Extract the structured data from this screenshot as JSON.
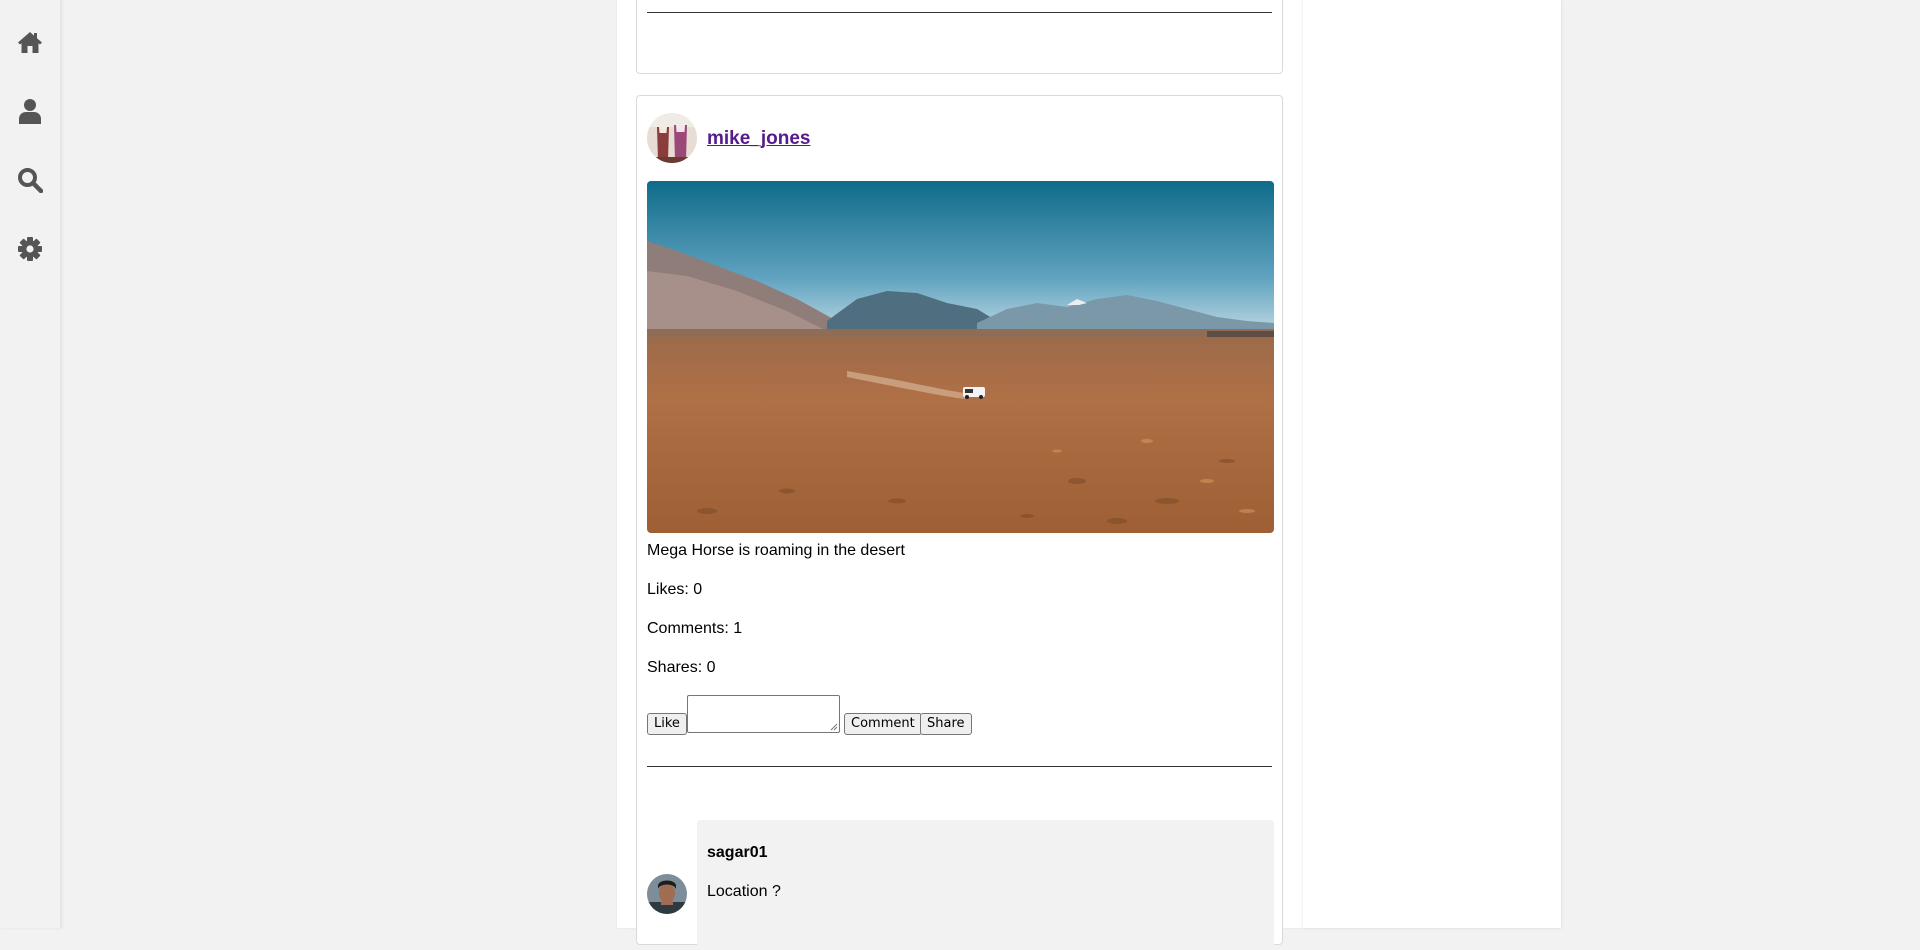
{
  "nav": {
    "items": [
      {
        "icon": "home-icon"
      },
      {
        "icon": "user-icon"
      },
      {
        "icon": "search-icon"
      },
      {
        "icon": "gear-icon"
      }
    ],
    "icon_color": "#555555"
  },
  "post": {
    "username": "mike_jones",
    "caption": "Mega Horse is roaming in the desert",
    "likes_text": "Likes: 0",
    "comments_text": "Comments: 1",
    "shares_text": "Shares: 0",
    "like_label": "Like",
    "comment_label": "Comment",
    "share_label": "Share",
    "comment_input_value": ""
  },
  "comment": {
    "author": "sagar01",
    "text": "Location ?"
  },
  "colors": {
    "link": "#551a8b",
    "page_bg": "#f2f2f2",
    "card_bg": "#ffffff"
  }
}
